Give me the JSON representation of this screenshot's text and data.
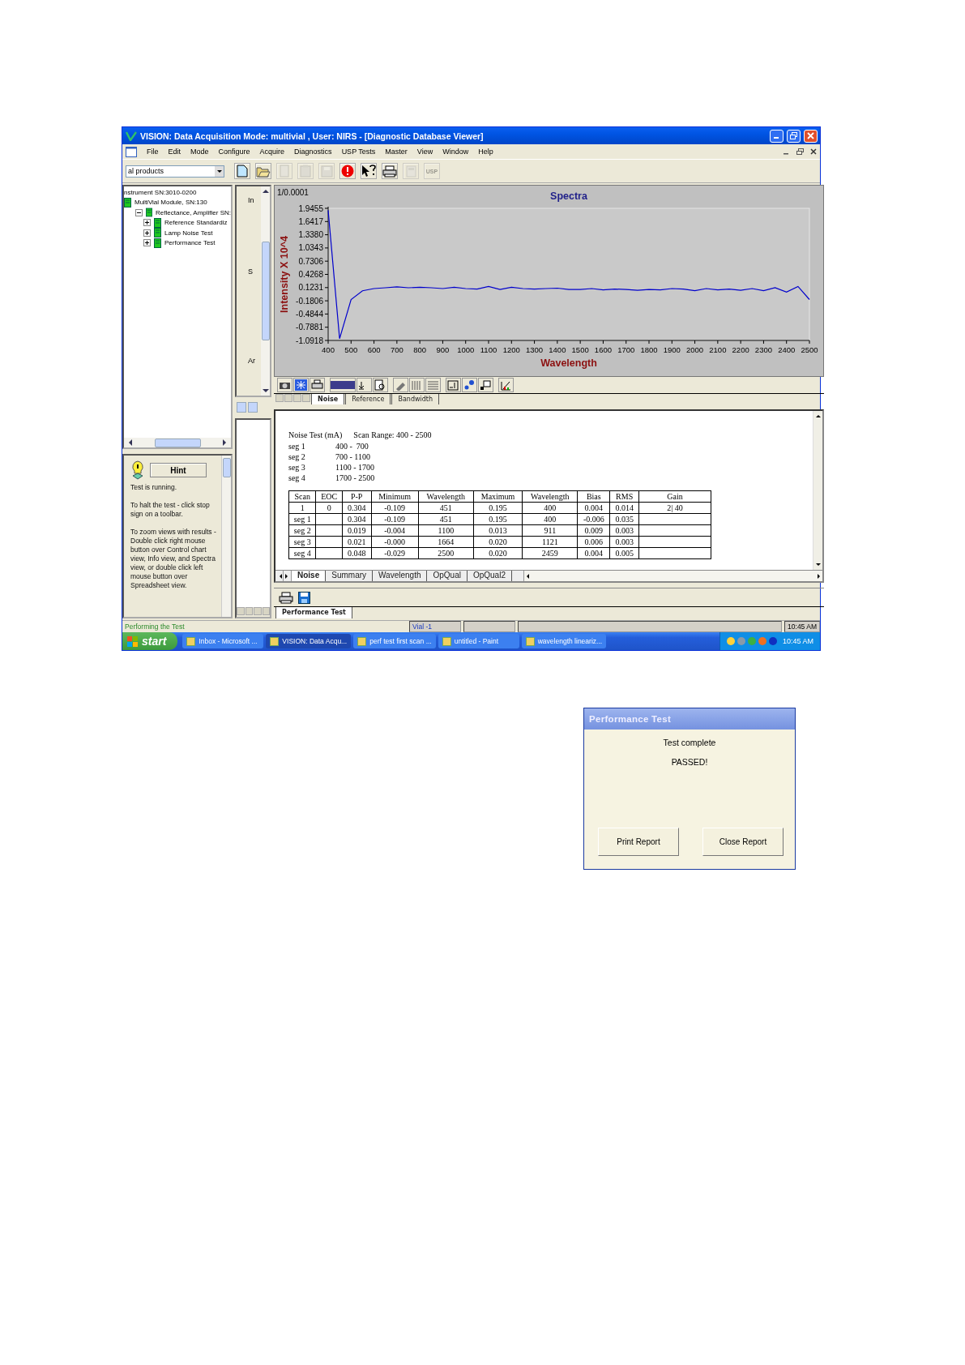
{
  "window": {
    "title": "VISION: Data Acquisition Mode: multivial , User: NIRS - [Diagnostic Database Viewer]"
  },
  "menu": [
    "File",
    "Edit",
    "Mode",
    "Configure",
    "Acquire",
    "Diagnostics",
    "USP Tests",
    "Master",
    "View",
    "Window",
    "Help"
  ],
  "toolbar": {
    "product_combo": {
      "value": "al products"
    },
    "tools": [
      {
        "kind": "new",
        "disabled": false
      },
      {
        "kind": "open",
        "disabled": false
      },
      {
        "kind": "copy",
        "disabled": true
      },
      {
        "kind": "paste",
        "disabled": true
      },
      {
        "kind": "save",
        "disabled": true
      },
      {
        "kind": "stop",
        "disabled": false
      },
      {
        "kind": "help",
        "disabled": false
      },
      {
        "kind": "print",
        "disabled": false
      },
      {
        "kind": "calc",
        "disabled": true
      },
      {
        "kind": "text",
        "label": "USP",
        "disabled": true
      }
    ]
  },
  "tree": {
    "items": [
      {
        "label": "nstrument SN:3010-0200",
        "children": [
          {
            "label": "MultiVial Module, SN:130",
            "children": [
              {
                "label": "Reflectance, Amplifier SN:",
                "expanded": true,
                "children": [
                  {
                    "label": "Reference Standardiz",
                    "expanded": false
                  },
                  {
                    "label": "Lamp Noise Test",
                    "expanded": false
                  },
                  {
                    "label": "Performance Test",
                    "expanded": false
                  }
                ]
              }
            ]
          }
        ]
      }
    ]
  },
  "hint_panel": {
    "button": "Hint",
    "messages": [
      "Test is running.",
      "To halt the test - click stop sign on a toolbar.",
      "To zoom views with results - Double click right mouse button over Control chart view, Info view, and Spectra view, or double click left mouse button over Spreadsheet view."
    ]
  },
  "side_labels": [
    "In",
    "S",
    "Ar"
  ],
  "spectra": {
    "scale_label": "1/0.0001",
    "chart_data": {
      "type": "line",
      "title": "Spectra",
      "xlabel": "Wavelength",
      "ylabel": "Intensity X 10^4",
      "x": [
        400,
        450,
        500,
        550,
        600,
        650,
        700,
        750,
        800,
        850,
        900,
        950,
        1000,
        1050,
        1100,
        1150,
        1200,
        1250,
        1300,
        1350,
        1400,
        1450,
        1500,
        1550,
        1600,
        1650,
        1700,
        1750,
        1800,
        1850,
        1900,
        1950,
        2000,
        2050,
        2100,
        2150,
        2200,
        2250,
        2300,
        2350,
        2400,
        2450,
        2500
      ],
      "series": [
        {
          "color": "#0000cc",
          "values": [
            1.9,
            -1.05,
            -0.15,
            0.05,
            0.1,
            0.12,
            0.14,
            0.12,
            0.13,
            0.12,
            0.1,
            0.13,
            0.1,
            0.09,
            0.15,
            0.08,
            0.13,
            0.1,
            0.09,
            0.1,
            0.11,
            0.08,
            0.08,
            0.1,
            0.07,
            0.09,
            0.08,
            0.06,
            0.08,
            0.07,
            0.1,
            0.09,
            0.05,
            0.1,
            0.07,
            0.09,
            0.06,
            0.1,
            0.05,
            0.12,
            0.02,
            0.15,
            -0.15
          ]
        }
      ],
      "xlim": [
        400,
        2500
      ],
      "ylim": [
        -1.0918,
        1.9455
      ],
      "xticks": [
        400,
        500,
        600,
        700,
        800,
        900,
        1000,
        1100,
        1200,
        1300,
        1400,
        1500,
        1600,
        1700,
        1800,
        1900,
        2000,
        2100,
        2200,
        2300,
        2400,
        2500
      ],
      "yticks": [
        {
          "value": 1.9455,
          "label": "1.9455"
        },
        {
          "value": 1.6417,
          "label": "1.6417"
        },
        {
          "value": 1.338,
          "label": "1.3380"
        },
        {
          "value": 1.0343,
          "label": "1.0343"
        },
        {
          "value": 0.7306,
          "label": "0.7306"
        },
        {
          "value": 0.4268,
          "label": "0.4268"
        },
        {
          "value": 0.1231,
          "label": "0.1231"
        },
        {
          "value": -0.1806,
          "label": "-0.1806"
        },
        {
          "value": -0.4844,
          "label": "-0.4844"
        },
        {
          "value": -0.7881,
          "label": "-0.7881"
        },
        {
          "value": -1.0918,
          "label": "-1.0918"
        }
      ]
    }
  },
  "chart_tabs": [
    {
      "label": "Noise",
      "selected": true
    },
    {
      "label": "Reference",
      "selected": false
    },
    {
      "label": "Bandwidth",
      "selected": false
    }
  ],
  "report": {
    "heading": "Noise Test (mA)",
    "scan_range": "Scan Range: 400 - 2500",
    "segments": [
      {
        "name": "seg 1",
        "range": "400 -  700"
      },
      {
        "name": "seg 2",
        "range": "700 - 1100"
      },
      {
        "name": "seg 3",
        "range": "1100 - 1700"
      },
      {
        "name": "seg 4",
        "range": "1700 - 2500"
      }
    ],
    "table": {
      "columns": [
        "Scan",
        "EOC",
        "P-P",
        "Minimum",
        "Wavelength",
        "Maximum",
        "Wavelength",
        "Bias",
        "RMS",
        "Gain"
      ],
      "rows": [
        [
          "1",
          "0",
          "0.304",
          "-0.109",
          "451",
          "0.195",
          "400",
          "0.004",
          "0.014",
          "2| 40"
        ],
        [
          "seg 1",
          null,
          "0.304",
          "-0.109",
          "451",
          "0.195",
          "400",
          "-0.006",
          "0.035",
          null
        ],
        [
          "seg 2",
          null,
          "0.019",
          "-0.004",
          "1100",
          "0.013",
          "911",
          "0.009",
          "0.003",
          null
        ],
        [
          "seg 3",
          null,
          "0.021",
          "-0.000",
          "1664",
          "0.020",
          "1121",
          "0.006",
          "0.003",
          null
        ],
        [
          "seg 4",
          null,
          "0.048",
          "-0.029",
          "2500",
          "0.020",
          "2459",
          "0.004",
          "0.005",
          null
        ]
      ]
    }
  },
  "sheet_tabs": [
    {
      "label": "Noise",
      "selected": true
    },
    {
      "label": "Summary",
      "selected": false
    },
    {
      "label": "Wavelength",
      "selected": false
    },
    {
      "label": "OpQual",
      "selected": false
    },
    {
      "label": "OpQual2",
      "selected": false
    }
  ],
  "view_tabs": [
    {
      "label": "Performance Test",
      "selected": true
    }
  ],
  "status_bar": {
    "message": "Performing the  Test",
    "vial": "Vial -1",
    "time": "10:45 AM"
  },
  "taskbar": {
    "start": "start",
    "tasks": [
      {
        "label": "Inbox - Microsoft ...",
        "selected": false
      },
      {
        "label": "VISION: Data Acqu...",
        "selected": true
      },
      {
        "label": "perf test first scan ...",
        "selected": false
      },
      {
        "label": "untitled - Paint",
        "selected": false
      },
      {
        "label": "wavelength lineariz...",
        "selected": false
      }
    ],
    "clock": "10:45 AM"
  },
  "dialog": {
    "title": "Performance Test",
    "lines": [
      "Test complete",
      "PASSED!"
    ],
    "buttons": [
      "Print Report",
      "Close Report"
    ]
  }
}
